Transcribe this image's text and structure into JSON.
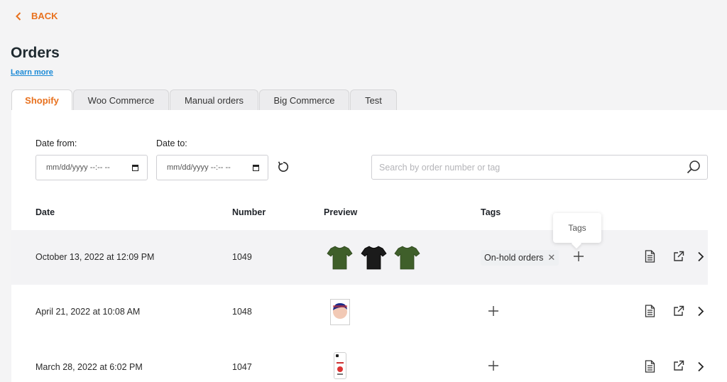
{
  "nav": {
    "back_label": "BACK"
  },
  "page": {
    "title": "Orders",
    "learn_more": "Learn more"
  },
  "tabs": [
    {
      "label": "Shopify",
      "active": true
    },
    {
      "label": "Woo Commerce",
      "active": false
    },
    {
      "label": "Manual orders",
      "active": false
    },
    {
      "label": "Big Commerce",
      "active": false
    },
    {
      "label": "Test",
      "active": false
    }
  ],
  "filters": {
    "date_from_label": "Date from:",
    "date_to_label": "Date to:",
    "date_from_value": "mm/dd/yyyy --:-- --",
    "date_to_value": "mm/dd/yyyy --:-- --",
    "search_placeholder": "Search by order number or tag"
  },
  "table": {
    "headers": {
      "date": "Date",
      "number": "Number",
      "preview": "Preview",
      "tags": "Tags"
    },
    "rows": [
      {
        "date": "October 13, 2022 at 12:09 PM",
        "number": "1049",
        "tags": [
          "On-hold orders"
        ],
        "preview": [
          "green-tshirt",
          "black-tshirt",
          "green-tshirt"
        ]
      },
      {
        "date": "April 21, 2022 at 10:08 AM",
        "number": "1048",
        "tags": [],
        "preview": [
          "portrait-print"
        ]
      },
      {
        "date": "March 28, 2022 at 6:02 PM",
        "number": "1047",
        "tags": [],
        "preview": [
          "phone-case"
        ]
      }
    ]
  },
  "tooltip": {
    "text": "Tags"
  },
  "icons": {
    "back": "chevron-left-icon",
    "calendar": "calendar-icon",
    "reset": "refresh-icon",
    "search": "search-icon",
    "add_tag": "plus-icon",
    "invoice": "document-icon",
    "open": "external-link-icon",
    "details": "chevron-right-icon",
    "remove_tag": "close-icon"
  },
  "colors": {
    "accent": "#e8711e",
    "link": "#1b8ad6",
    "shirt_green": "#3f5f2a",
    "shirt_black": "#1b1b1b"
  }
}
